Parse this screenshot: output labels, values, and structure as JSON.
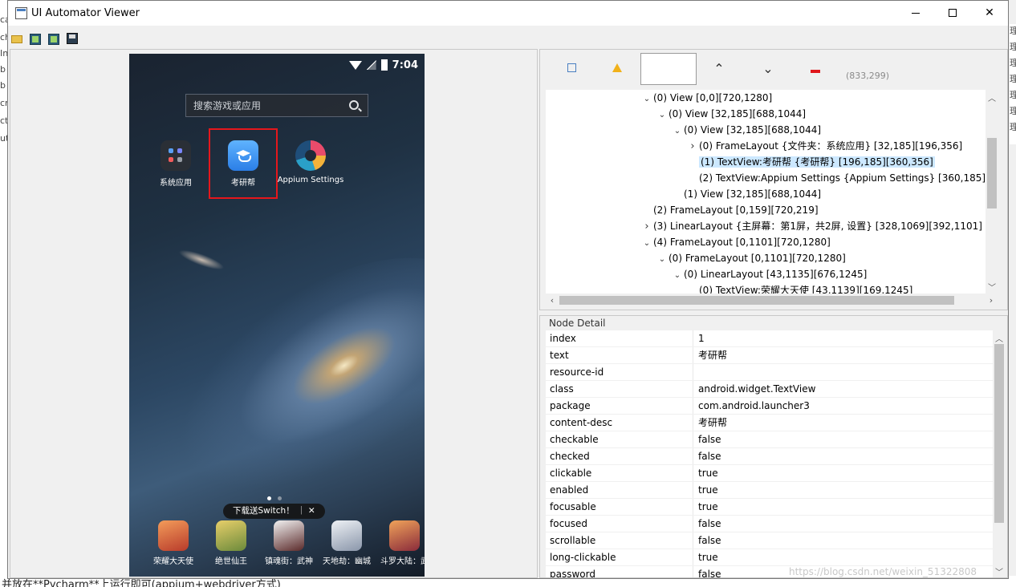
{
  "window": {
    "title": "UI Automator Viewer",
    "min_label": "",
    "max_label": "",
    "close_label": "✕"
  },
  "toolbar": {
    "open_icon": "folder-open-icon",
    "screenshot_icon": "device-screenshot-icon",
    "screenshot_compressed_icon": "device-screenshot-compressed-icon",
    "save_icon": "save-icon"
  },
  "device": {
    "time": "7:04",
    "search_placeholder": "搜索游戏或应用",
    "apps": [
      {
        "label": "系统应用"
      },
      {
        "label": "考研帮"
      },
      {
        "label": "Appium Settings"
      }
    ],
    "promo": "下载送Switch！ ｜ ✕",
    "dock": [
      {
        "label": "荣耀大天使",
        "color": "#c0392b"
      },
      {
        "label": "绝世仙王",
        "color": "#b7863c"
      },
      {
        "label": "镇魂街：武神",
        "color": "#5b2a2a"
      },
      {
        "label": "天地劫：幽城",
        "color": "#9aa4b5"
      },
      {
        "label": "斗罗大陆：武",
        "color": "#a33b3b"
      }
    ]
  },
  "tree_toolbar": {
    "coords": "(833,299)"
  },
  "tree": [
    {
      "indent": 0,
      "twisty": "down",
      "label": "(0) View [0,0][720,1280]"
    },
    {
      "indent": 1,
      "twisty": "down",
      "label": "(0) View [32,185][688,1044]"
    },
    {
      "indent": 2,
      "twisty": "down",
      "label": "(0) View [32,185][688,1044]"
    },
    {
      "indent": 3,
      "twisty": "right",
      "label": "(0) FrameLayout {文件夹：系统应用} [32,185][196,356]"
    },
    {
      "indent": 3,
      "twisty": "none",
      "label": "(1) TextView:考研帮 {考研帮} [196,185][360,356]",
      "selected": true
    },
    {
      "indent": 3,
      "twisty": "none",
      "label": "(2) TextView:Appium Settings {Appium Settings} [360,185][524,356]"
    },
    {
      "indent": 2,
      "twisty": "none",
      "label": "(1) View [32,185][688,1044]"
    },
    {
      "indent": 0,
      "twisty": "none",
      "label": "(2) FrameLayout [0,159][720,219]"
    },
    {
      "indent": 0,
      "twisty": "right",
      "label": "(3) LinearLayout {主屏幕：第1屏，共2屏, 设置} [328,1069][392,1101]"
    },
    {
      "indent": 0,
      "twisty": "down",
      "label": "(4) FrameLayout [0,1101][720,1280]"
    },
    {
      "indent": 1,
      "twisty": "down",
      "label": "(0) FrameLayout [0,1101][720,1280]"
    },
    {
      "indent": 2,
      "twisty": "down",
      "label": "(0) LinearLayout [43,1135][676,1245]"
    },
    {
      "indent": 3,
      "twisty": "none",
      "label": "(0) TextView:荣耀大天使 [43,1139][169,1245]"
    }
  ],
  "detail": {
    "title": "Node Detail",
    "rows": [
      {
        "key": "index",
        "value": "1"
      },
      {
        "key": "text",
        "value": "考研帮"
      },
      {
        "key": "resource-id",
        "value": ""
      },
      {
        "key": "class",
        "value": "android.widget.TextView"
      },
      {
        "key": "package",
        "value": "com.android.launcher3"
      },
      {
        "key": "content-desc",
        "value": "考研帮"
      },
      {
        "key": "checkable",
        "value": "false"
      },
      {
        "key": "checked",
        "value": "false"
      },
      {
        "key": "clickable",
        "value": "true"
      },
      {
        "key": "enabled",
        "value": "true"
      },
      {
        "key": "focusable",
        "value": "true"
      },
      {
        "key": "focused",
        "value": "false"
      },
      {
        "key": "scrollable",
        "value": "false"
      },
      {
        "key": "long-clickable",
        "value": "true"
      },
      {
        "key": "password",
        "value": "false"
      }
    ]
  },
  "watermark": "https://blog.csdn.net/weixin_51322808",
  "background": {
    "bottom_text": "并放在**Pycharm**上运行即可(appium+webdriver方式)",
    "left_chars": [
      "ca",
      "ch",
      "In",
      "b",
      "b",
      "cr",
      "ct",
      "ut"
    ],
    "right_chars": [
      "理",
      "理",
      "理",
      "理",
      "理",
      "理",
      "理"
    ]
  }
}
